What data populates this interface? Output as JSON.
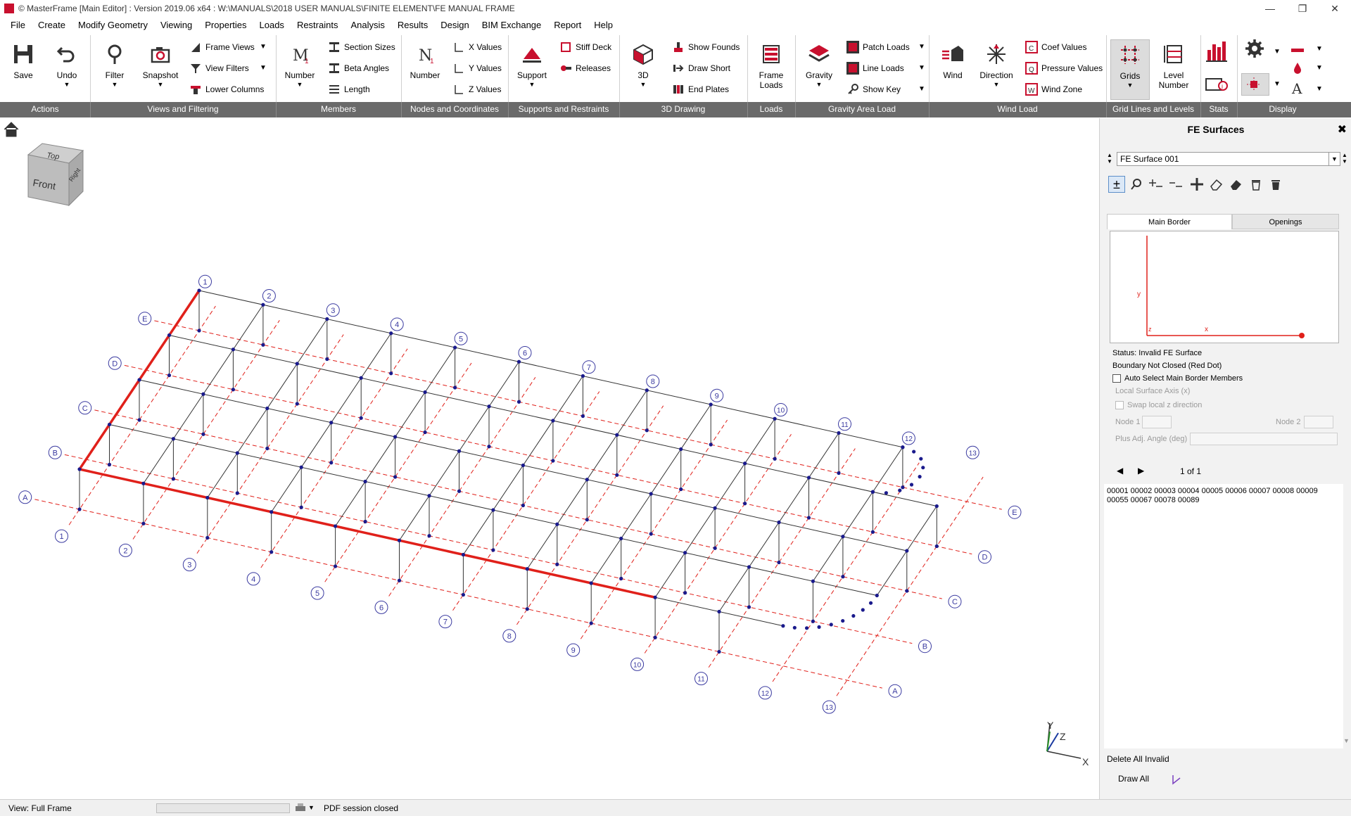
{
  "window": {
    "title": "© MasterFrame [Main Editor] : Version 2019.06 x64 : W:\\MANUALS\\2018 USER MANUALS\\FINITE ELEMENT\\FE MANUAL FRAME",
    "controls": [
      "—",
      "❐",
      "✕"
    ]
  },
  "menu": [
    "File",
    "Create",
    "Modify Geometry",
    "Viewing",
    "Properties",
    "Loads",
    "Restraints",
    "Analysis",
    "Results",
    "Design",
    "BIM Exchange",
    "Report",
    "Help"
  ],
  "ribbon": {
    "groups": [
      "Actions",
      "Views and Filtering",
      "Members",
      "Nodes and Coordinates",
      "Supports and Restraints",
      "3D Drawing",
      "Loads",
      "Gravity Area Load",
      "Wind Load",
      "Grid Lines and Levels",
      "Stats",
      "Display"
    ],
    "save": "Save",
    "undo": "Undo",
    "filter": "Filter",
    "snapshot": "Snapshot",
    "frame_views": "Frame Views",
    "view_filters": "View Filters",
    "lower_columns": "Lower Columns",
    "member_number": "Number",
    "section_sizes": "Section Sizes",
    "beta_angles": "Beta Angles",
    "length": "Length",
    "node_number": "Number",
    "x_values": "X Values",
    "y_values": "Y Values",
    "z_values": "Z Values",
    "support": "Support",
    "stiff_deck": "Stiff Deck",
    "releases": "Releases",
    "three_d": "3D",
    "show_founds": "Show Founds",
    "draw_short": "Draw Short",
    "end_plates": "End Plates",
    "frame_loads": "Frame Loads",
    "gravity": "Gravity",
    "patch_loads": "Patch Loads",
    "line_loads": "Line Loads",
    "show_key": "Show Key",
    "wind": "Wind",
    "direction": "Direction",
    "coef_values": "Coef Values",
    "pressure_values": "Pressure Values",
    "wind_zone": "Wind Zone",
    "grids": "Grids",
    "level_number": "Level Number"
  },
  "viewcube": {
    "top": "Top",
    "front": "Front",
    "right": "Right"
  },
  "axes": {
    "x": "X",
    "y": "Y",
    "z": "Z"
  },
  "grid_labels": {
    "numbers": [
      "1",
      "2",
      "3",
      "4",
      "5",
      "6",
      "7",
      "8",
      "9",
      "10",
      "11",
      "12",
      "13"
    ],
    "letters": [
      "A",
      "B",
      "C",
      "D",
      "E"
    ]
  },
  "panel": {
    "title": "FE Surfaces",
    "close": "✖",
    "surface_name": "FE Surface 001",
    "tabs": [
      "Main Border",
      "Openings"
    ],
    "preview_axes": {
      "y": "y",
      "z": "z",
      "x": "x"
    },
    "status": "Status: Invalid FE Surface",
    "boundary": "Boundary Not Closed (Red Dot)",
    "auto_select": "Auto Select Main Border Members",
    "local_axis": "Local Surface Axis (x)",
    "swap_local": "Swap local z direction",
    "node1": "Node 1",
    "node2": "Node 2",
    "plus_adj": "Plus Adj. Angle (deg)",
    "page": "1 of 1",
    "members_line1": "00001 00002 00003 00004 00005 00006 00007 00008 00009",
    "members_line2": "00055 00067 00078 00089",
    "delete_invalid": "Delete All Invalid",
    "draw_all": "Draw All"
  },
  "status": {
    "view": "View: Full Frame",
    "pdf": "PDF session closed"
  }
}
